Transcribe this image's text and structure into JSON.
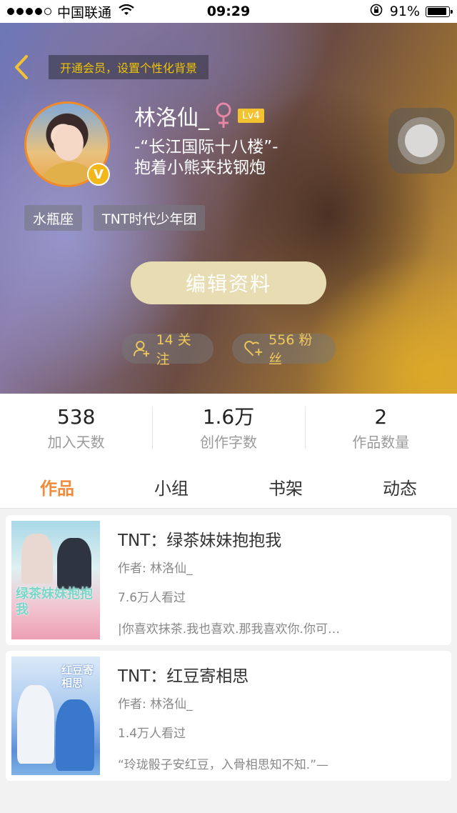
{
  "status_bar": {
    "carrier": "中国联通",
    "time": "09:29",
    "battery": "91%",
    "battery_level": 0.91
  },
  "header": {
    "vip_hint": "开通会员，设置个性化背景"
  },
  "profile": {
    "username": "林洛仙_",
    "gender_icon": "female-icon",
    "level": "Lv4",
    "verified_mark": "V",
    "bio_line1": "-“长江国际十八楼”-",
    "bio_line2": "抱着小熊来找钢炮",
    "tags": [
      "水瓶座",
      "TNT时代少年团"
    ],
    "edit_button": "编辑资料",
    "following": "14 关注",
    "fans": "556 粉丝"
  },
  "stats": [
    {
      "value": "538",
      "label": "加入天数"
    },
    {
      "value": "1.6万",
      "label": "创作字数"
    },
    {
      "value": "2",
      "label": "作品数量"
    }
  ],
  "tabs": [
    {
      "label": "作品",
      "active": true
    },
    {
      "label": "小组",
      "active": false
    },
    {
      "label": "书架",
      "active": false
    },
    {
      "label": "动态",
      "active": false
    }
  ],
  "works": [
    {
      "title": "TNT：绿茶妹妹抱抱我",
      "author": "作者: 林洛仙_",
      "views": "7.6万人看过",
      "excerpt": "|你喜欢抹茶.我也喜欢.那我喜欢你.你可…",
      "cover_text": "绿茶妹妹抱抱我"
    },
    {
      "title": "TNT：红豆寄相思",
      "author": "作者: 林洛仙_",
      "views": "1.4万人看过",
      "excerpt": "“玲珑骰子安红豆，入骨相思知不知.”—",
      "cover_text": "红豆寄相思"
    }
  ],
  "colors": {
    "accent": "#f08a3c",
    "vip_text": "#f0c400",
    "level_badge": "#f2c230",
    "edit_button": "#e8dcb2",
    "chip_text": "#f0c85a"
  }
}
